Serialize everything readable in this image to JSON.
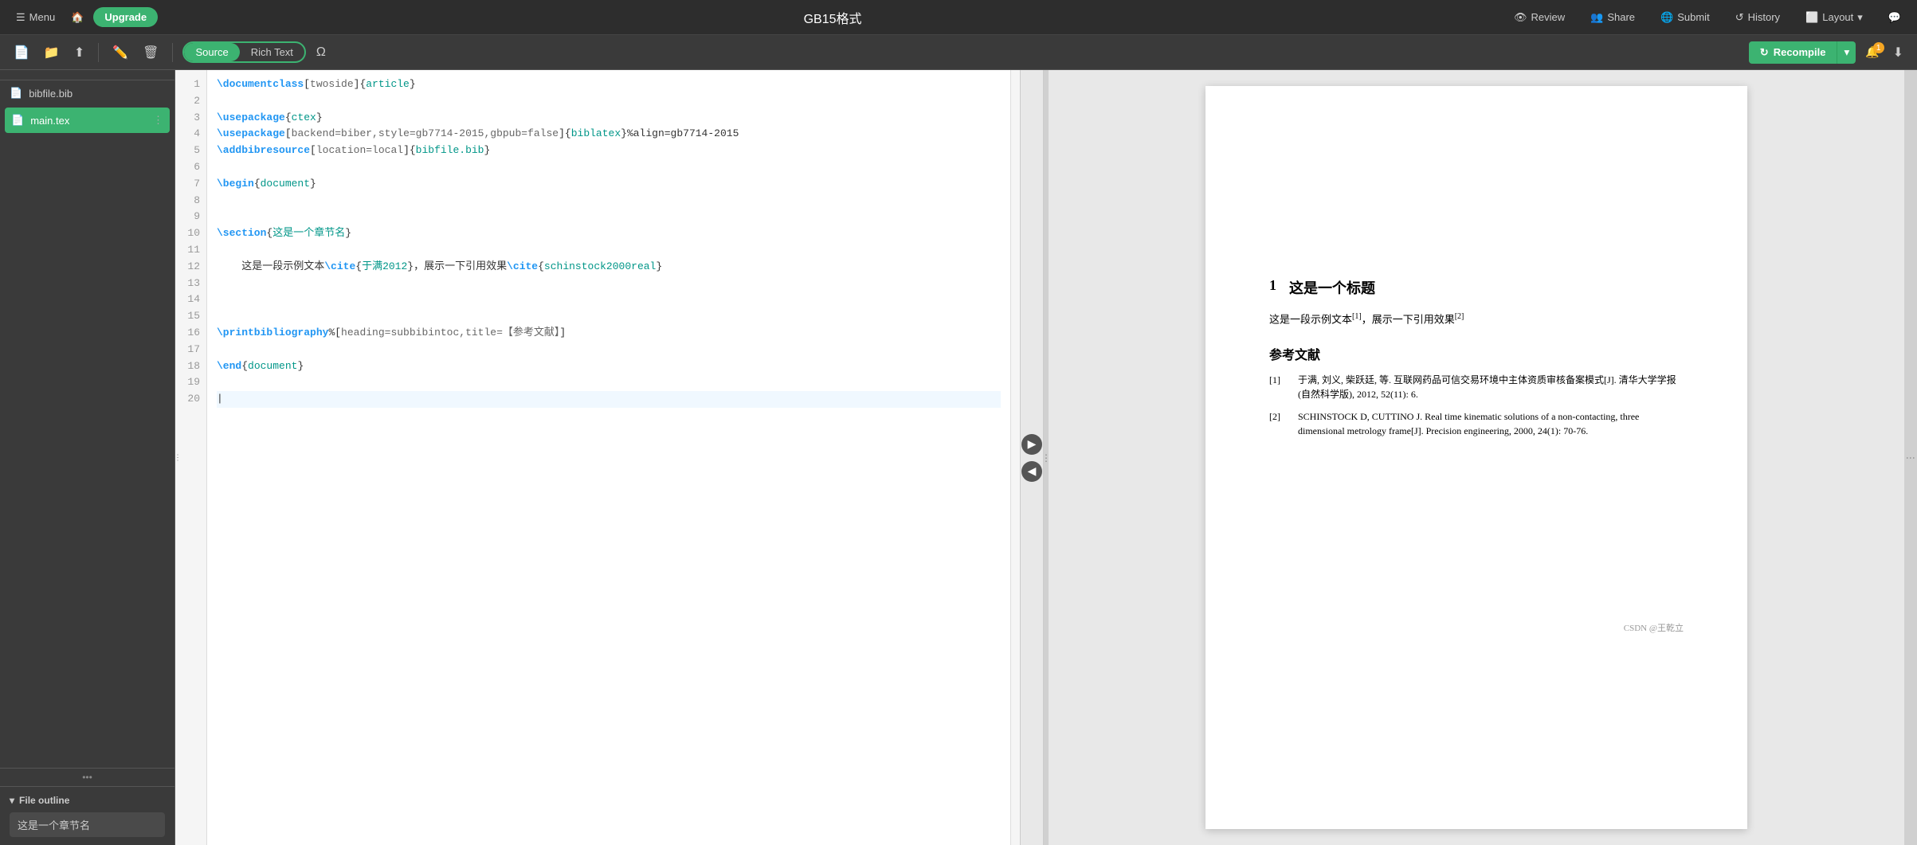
{
  "app": {
    "title": "GB15格式"
  },
  "navbar": {
    "menu_label": "Menu",
    "upgrade_label": "Upgrade",
    "review_label": "Review",
    "share_label": "Share",
    "submit_label": "Submit",
    "history_label": "History",
    "layout_label": "Layout"
  },
  "toolbar": {
    "source_label": "Source",
    "rich_text_label": "Rich Text",
    "recompile_label": "Recompile",
    "notification_count": "1"
  },
  "sidebar": {
    "files": [
      {
        "name": "bibfile.bib",
        "active": false,
        "icon": "📄"
      },
      {
        "name": "main.tex",
        "active": true,
        "icon": "📄"
      }
    ],
    "file_outline_label": "File outline",
    "outline_items": [
      {
        "text": "这是一个章节名"
      }
    ]
  },
  "editor": {
    "lines": [
      {
        "num": 1,
        "content": "\\documentclass[twoside]{article}",
        "type": "code"
      },
      {
        "num": 2,
        "content": "",
        "type": "empty"
      },
      {
        "num": 3,
        "content": "\\usepackage{ctex}",
        "type": "code"
      },
      {
        "num": 4,
        "content": "\\usepackage[backend=biber,style=gb7714-2015,gbpub=false]{biblatex}%align=gb7714-2015",
        "type": "code"
      },
      {
        "num": 5,
        "content": "\\addbibresource[location=local]{bibfile.bib}",
        "type": "code"
      },
      {
        "num": 6,
        "content": "",
        "type": "empty"
      },
      {
        "num": 7,
        "content": "\\begin{document}",
        "type": "code"
      },
      {
        "num": 8,
        "content": "",
        "type": "empty"
      },
      {
        "num": 9,
        "content": "",
        "type": "empty"
      },
      {
        "num": 10,
        "content": "\\section{这是一个章节名}",
        "type": "code"
      },
      {
        "num": 11,
        "content": "",
        "type": "empty"
      },
      {
        "num": 12,
        "content": "    这是一段示例文本\\cite{于满2012}，展示一下引用效果\\cite{schinstock2000real}",
        "type": "code"
      },
      {
        "num": 13,
        "content": "",
        "type": "empty"
      },
      {
        "num": 14,
        "content": "",
        "type": "empty"
      },
      {
        "num": 15,
        "content": "",
        "type": "empty"
      },
      {
        "num": 16,
        "content": "\\printbibliography%[heading=subbibintoc,title=【参考文献】]",
        "type": "code"
      },
      {
        "num": 17,
        "content": "",
        "type": "empty"
      },
      {
        "num": 18,
        "content": "\\end{document}",
        "type": "code"
      },
      {
        "num": 19,
        "content": "",
        "type": "empty"
      },
      {
        "num": 20,
        "content": "",
        "type": "cursor"
      }
    ]
  },
  "preview": {
    "section_num": "1",
    "section_title": "这是一个标题",
    "body_text": "这是一段示例文本",
    "cite1": "[1]",
    "cite_sep": "，展示一下引用效果",
    "cite2": "[2]",
    "references_title": "参考文献",
    "references": [
      {
        "num": "[1]",
        "text": "于满, 刘义, 柴跃廷, 等. 互联网药品可信交易环境中主体资质审核备案模式[J]. 清华大学学报 (自然科学版), 2012, 52(11): 6."
      },
      {
        "num": "[2]",
        "text": "SCHINSTOCK D, CUTTINO J. Real time kinematic solutions of a non-contacting, three dimensional metrology frame[J]. Precision engineering, 2000, 24(1): 70-76."
      }
    ],
    "watermark": "CSDN @王乾立"
  }
}
